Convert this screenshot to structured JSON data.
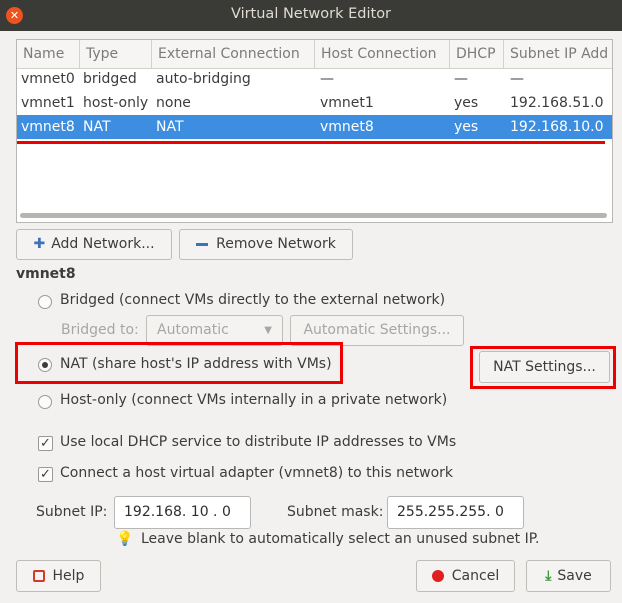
{
  "window": {
    "title": "Virtual Network Editor"
  },
  "table": {
    "columns": [
      "Name",
      "Type",
      "External Connection",
      "Host Connection",
      "DHCP",
      "Subnet IP Add"
    ],
    "rows": [
      [
        "vmnet0",
        "bridged",
        "auto-bridging",
        "—",
        "—",
        "—"
      ],
      [
        "vmnet1",
        "host-only",
        "none",
        "vmnet1",
        "yes",
        "192.168.51.0"
      ],
      [
        "vmnet8",
        "NAT",
        "NAT",
        "vmnet8",
        "yes",
        "192.168.10.0"
      ]
    ],
    "selected_row": 2
  },
  "buttons": {
    "add_network": "Add Network...",
    "remove_network": "Remove Network",
    "nat_settings": "NAT Settings...",
    "automatic_settings": "Automatic Settings...",
    "help": "Help",
    "cancel": "Cancel",
    "save": "Save"
  },
  "section_title": "vmnet8",
  "options": {
    "bridged": "Bridged (connect VMs directly to the external network)",
    "bridged_to_label": "Bridged to:",
    "bridged_to_value": "Automatic",
    "nat": "NAT (share host's IP address with VMs)",
    "host_only": "Host-only (connect VMs internally in a private network)",
    "selected": "nat"
  },
  "checkboxes": {
    "dhcp": "Use local DHCP service to distribute IP addresses to VMs",
    "host_adapter": "Connect a host virtual adapter (vmnet8) to this network"
  },
  "subnet": {
    "ip_label": "Subnet IP:",
    "ip_value": "192.168. 10 .  0",
    "mask_label": "Subnet mask:",
    "mask_value": "255.255.255.  0",
    "hint": "Leave blank to automatically select an unused subnet IP."
  },
  "colors": {
    "selection": "#3d8ee0",
    "highlight": "#ee0000",
    "titlebar": "#3a3a37",
    "close": "#e95420"
  }
}
